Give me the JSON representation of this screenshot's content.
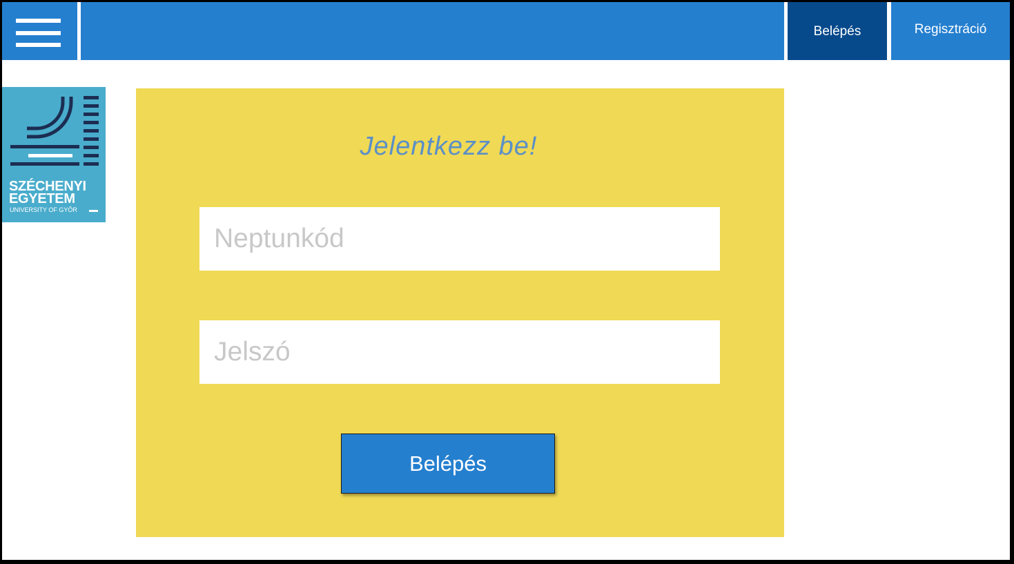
{
  "header": {
    "menu_icon": "hamburger-menu-icon",
    "login_label": "Belépés",
    "register_label": "Regisztráció"
  },
  "logo": {
    "line1": "SZÉCHENYI",
    "line2": "EGYETEM",
    "line3": "UNIVERSITY OF GYŐR"
  },
  "login_form": {
    "title": "Jelentkezz be!",
    "neptun_placeholder": "Neptunkód",
    "password_placeholder": "Jelszó",
    "submit_label": "Belépés"
  },
  "colors": {
    "header_blue": "#257fcf",
    "active_nav_blue": "#074a8c",
    "panel_yellow": "#f0d955",
    "logo_teal": "#4aaccc",
    "logo_navy": "#1c2d52",
    "title_blue": "#5b8fc7",
    "placeholder_gray": "#c8c8c8"
  }
}
